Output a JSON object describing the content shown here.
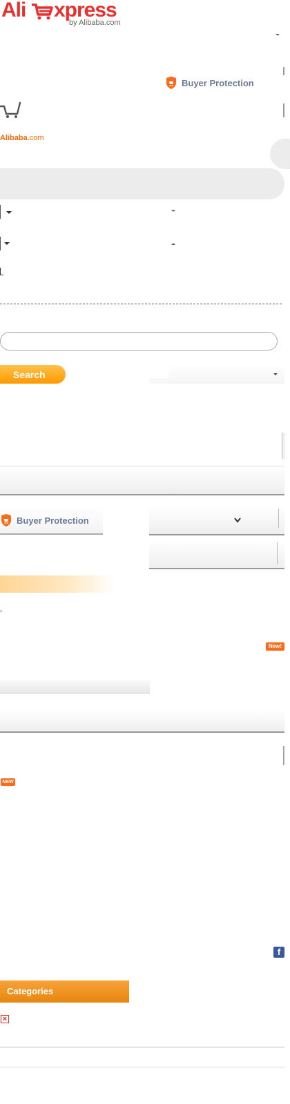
{
  "header": {
    "logo_ali": "Ali",
    "logo_xpress": "xpress",
    "logo_by": "by Alibaba.com",
    "buyer_protection": "Buyer Protection",
    "alibaba_brand": "Alibaba",
    "alibaba_com": ".com"
  },
  "search": {
    "input_value": "",
    "button_label": "Search"
  },
  "promo": {
    "buyer_protection": "Buyer Protection",
    "new_badge": "New!",
    "new_badge_small": "NEW"
  },
  "sidebar": {
    "categories_label": "Categories"
  },
  "social": {
    "facebook_glyph": "f"
  },
  "colors": {
    "brand_red": "#e8312f",
    "accent_orange": "#ff9900",
    "buyer_protection_text": "#6b7a99",
    "facebook_blue": "#3b5998"
  }
}
